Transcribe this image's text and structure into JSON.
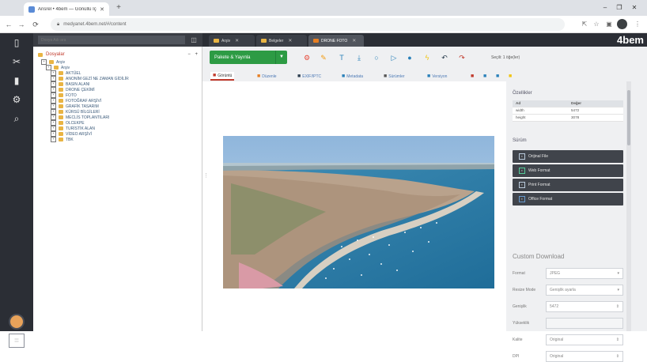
{
  "browser": {
    "tab_title": "Ansrel • 4bem — Gönüllü İçerik",
    "url": "medyanet.4bem.net/#/content",
    "new_tab_icon": "plus-icon",
    "window_controls": [
      "–",
      "❐",
      "✕"
    ]
  },
  "rail": {
    "icons": [
      "file-icon",
      "wrench-icon",
      "chart-icon",
      "gear-icon",
      "search-icon"
    ]
  },
  "tree": {
    "search_placeholder": "Dosya Adı ara",
    "root_label": "Dosyalar",
    "root_controls": "− +",
    "nodes": [
      {
        "label": "Arşiv",
        "level": 0
      },
      {
        "label": "Arşiv",
        "level": 1
      },
      {
        "label": "AKTÜEL",
        "level": 2
      },
      {
        "label": "ANONİM GEZİ NE ZAMAN GİDİLİR",
        "level": 2
      },
      {
        "label": "BASIN ALANI",
        "level": 2
      },
      {
        "label": "DRONE ÇEKİMİ",
        "level": 2
      },
      {
        "label": "FOTO",
        "level": 2
      },
      {
        "label": "FOTOĞRAF ARŞİVİ",
        "level": 2
      },
      {
        "label": "GRAFİK TASARIM",
        "level": 2
      },
      {
        "label": "KÜRSÜ BİLGİLERİ",
        "level": 2
      },
      {
        "label": "MECLİS TOPLANTILARI",
        "level": 2
      },
      {
        "label": "OLCEKPE",
        "level": 2
      },
      {
        "label": "TURİSTİK ALAN",
        "level": 2
      },
      {
        "label": "VİDEO ARŞİVİ",
        "level": 2
      },
      {
        "label": "TBK",
        "level": 2
      }
    ]
  },
  "appbar": {
    "tabs": [
      {
        "label": "Arşiv"
      },
      {
        "label": "Belgeler"
      },
      {
        "label": "DRONE FOTO"
      }
    ],
    "logo": "4bem"
  },
  "actionbar": {
    "download_label": "Pakete & Yayınla",
    "action_label": "Seçili: 1 öğe(ler)",
    "tools": [
      {
        "icon": "settings-icon",
        "color": "#e74c3c",
        "glyph": "⚙"
      },
      {
        "icon": "tag-icon",
        "color": "#f39c12",
        "glyph": "✎"
      },
      {
        "icon": "text-icon",
        "color": "#2980b9",
        "glyph": "T"
      },
      {
        "icon": "download-icon",
        "color": "#2980b9",
        "glyph": "⤓"
      },
      {
        "icon": "circle-icon",
        "color": "#2980b9",
        "glyph": "○"
      },
      {
        "icon": "play-icon",
        "color": "#2980b9",
        "glyph": "▷"
      },
      {
        "icon": "info-icon",
        "color": "#2980b9",
        "glyph": "●"
      },
      {
        "icon": "bolt-icon",
        "color": "#f1c40f",
        "glyph": "ϟ"
      },
      {
        "icon": "undo-icon",
        "color": "#2c3e50",
        "glyph": "↶"
      },
      {
        "icon": "redo-icon",
        "color": "#c0392b",
        "glyph": "↷"
      }
    ]
  },
  "viewtabs": [
    {
      "label": "Görüntü",
      "icon": "image-icon",
      "color": "#c0392b"
    },
    {
      "label": "Düzenle",
      "icon": "edit-icon",
      "color": "#e67e22"
    },
    {
      "label": "EXIF/IPTC",
      "icon": "camera-icon",
      "color": "#2c3e50"
    },
    {
      "label": "Metadata",
      "icon": "cloud-icon",
      "color": "#2980b9"
    },
    {
      "label": "Sürümler",
      "icon": "versions-icon",
      "color": "#555"
    },
    {
      "label": "Versiyon",
      "icon": "grid-icon",
      "color": "#2980b9"
    },
    {
      "label": "",
      "icon": "monitor-icon",
      "color": "#c0392b"
    },
    {
      "label": "",
      "icon": "share-icon",
      "color": "#2980b9"
    },
    {
      "label": "",
      "icon": "grid-icon",
      "color": "#2980b9"
    },
    {
      "label": "",
      "icon": "star-icon",
      "color": "#f1c40f"
    }
  ],
  "properties": {
    "title": "Özellikler",
    "headers": [
      "Ad",
      "Değer"
    ],
    "rows": [
      {
        "name": "width",
        "value": "5472"
      },
      {
        "name": "height",
        "value": "3078"
      }
    ]
  },
  "renditions": {
    "title": "Sürüm",
    "buttons": [
      {
        "label": "Orijinal File",
        "icon": "original-icon"
      },
      {
        "label": "Web Format",
        "icon": "web-icon"
      },
      {
        "label": "Print Format",
        "icon": "print-icon"
      },
      {
        "label": "Office Format",
        "icon": "office-icon"
      }
    ]
  },
  "custom_download": {
    "title": "Custom Download",
    "fields": [
      {
        "label": "Format",
        "value": "JPEG",
        "control": "select"
      },
      {
        "label": "Resize Mode",
        "value": "Genişlik ayarla",
        "control": "select"
      },
      {
        "label": "Genişlik",
        "value": "5472",
        "control": "stepper"
      },
      {
        "label": "Yükseklik",
        "value": "",
        "control": "disabled"
      },
      {
        "label": "Kalite",
        "value": "Original",
        "control": "stepper"
      },
      {
        "label": "DPI",
        "value": "Original",
        "control": "stepper"
      }
    ]
  }
}
